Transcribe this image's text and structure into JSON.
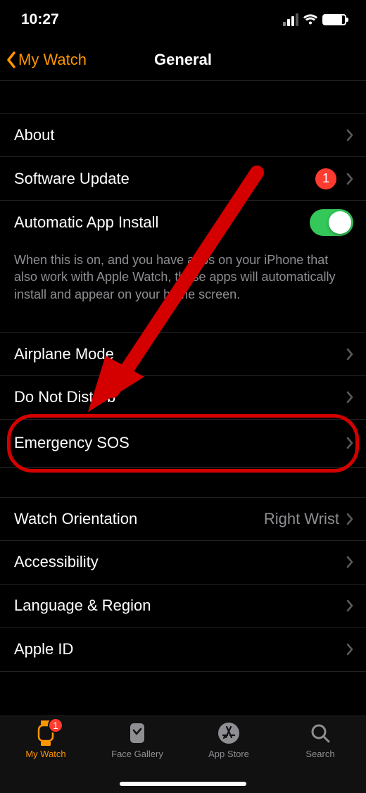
{
  "status": {
    "time": "10:27"
  },
  "nav": {
    "back": "My Watch",
    "title": "General"
  },
  "rows": {
    "about": "About",
    "software_update": "Software Update",
    "software_update_badge": "1",
    "auto_install": "Automatic App Install",
    "auto_install_footer": "When this is on, and you have apps on your iPhone that also work with Apple Watch, those apps will automatically install and appear on your home screen.",
    "airplane": "Airplane Mode",
    "dnd": "Do Not Disturb",
    "sos": "Emergency SOS",
    "orientation": "Watch Orientation",
    "orientation_value": "Right Wrist",
    "accessibility": "Accessibility",
    "language": "Language & Region",
    "appleid": "Apple ID"
  },
  "tabs": {
    "mywatch": "My Watch",
    "mywatch_badge": "1",
    "gallery": "Face Gallery",
    "appstore": "App Store",
    "search": "Search"
  }
}
